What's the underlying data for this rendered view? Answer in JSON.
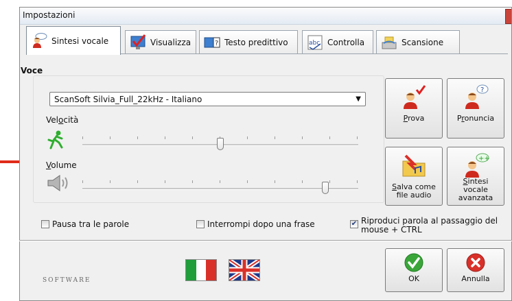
{
  "window": {
    "title": "Impostazioni"
  },
  "tabs": [
    {
      "label": "Sintesi vocale",
      "icon": "speaking-person-icon",
      "active": true
    },
    {
      "label": "Visualizza",
      "icon": "monitor-check-icon",
      "active": false
    },
    {
      "label": "Testo predittivo",
      "icon": "predictive-text-icon",
      "active": false
    },
    {
      "label": "Controlla",
      "icon": "abc-spellcheck-icon",
      "active": false
    },
    {
      "label": "Scansione",
      "icon": "scanner-icon",
      "active": false
    }
  ],
  "voice": {
    "group_title": "Voce",
    "selected_voice": "ScanSoft Silvia_Full_22kHz - Italiano",
    "speed": {
      "label_pre": "Vel",
      "label_u": "o",
      "label_post": "cità",
      "level": 0.5,
      "icon": "running-man-icon"
    },
    "volume": {
      "label_pre": "",
      "label_u": "V",
      "label_post": "olume",
      "level": 0.89,
      "icon": "speaker-icon"
    }
  },
  "buttons": {
    "prova": {
      "u": "P",
      "rest": "rova"
    },
    "pronuncia": {
      "pre": "P",
      "u": "r",
      "rest": "onuncia"
    },
    "salva": {
      "u": "S",
      "rest": "alva come",
      "line2": "file audio"
    },
    "sintesi_avanzata": {
      "u": "S",
      "rest": "intesi",
      "line2": "vocale",
      "line3": "avanzata"
    },
    "ok": "OK",
    "annulla": "Annulla"
  },
  "options": {
    "pausa": {
      "label": "Pausa tra le parole",
      "checked": false
    },
    "interrompi": {
      "label": "Interrompi dopo una frase",
      "checked": false
    },
    "riproduci": {
      "line1": "Riproduci parola al passaggio del",
      "line2": "mouse + CTRL",
      "checked": true
    }
  },
  "footer": {
    "brand": "SOFTWARE"
  },
  "colors": {
    "ok_green": "#3aa63a",
    "cancel_red": "#d9302a",
    "accent_red": "#e02b1a"
  }
}
